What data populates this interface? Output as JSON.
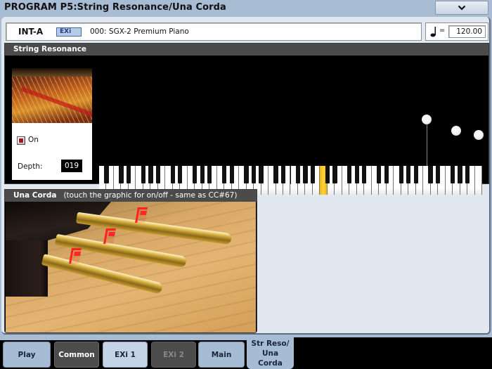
{
  "window": {
    "title": "PROGRAM P5:String Resonance/Una Corda",
    "menu_button_icon": "chevron-down-icon"
  },
  "program": {
    "bank": "INT-A",
    "engine_badge": "EXi",
    "name": "000: SGX-2 Premium Piano"
  },
  "tempo": {
    "icon": "quarter-note-icon",
    "equals": "=",
    "value": "120.00"
  },
  "string_resonance": {
    "header": "String Resonance",
    "image": "piano-strings-photo",
    "on_label": "On",
    "on_checked": true,
    "depth_label": "Depth:",
    "depth_value": "019",
    "keyboard": {
      "lowest_key": "A0",
      "highest_key": "C8",
      "white_key_count": 52,
      "highlighted_key_index_white": 30,
      "highlight_color": "#f0b800",
      "marker_white_key_indices": [
        44,
        48,
        51
      ]
    }
  },
  "una_corda": {
    "header": "Una Corda",
    "subtitle": "(touch the graphic for on/off - same as CC#67)",
    "image": "piano-pedals-photo",
    "marker_color": "#ff2020"
  },
  "tabs": [
    {
      "label": "Play",
      "style": "light"
    },
    {
      "label": "Common",
      "style": "dark"
    },
    {
      "label": "EXi 1",
      "style": "pale"
    },
    {
      "label": "EXi 2",
      "style": "disabled"
    },
    {
      "label": "Main",
      "style": "light"
    },
    {
      "label": "Str Reso/ Una Corda",
      "style": "active"
    }
  ]
}
